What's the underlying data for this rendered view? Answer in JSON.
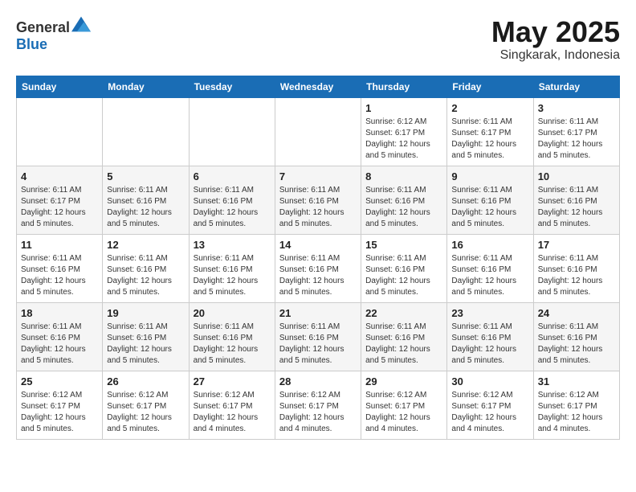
{
  "header": {
    "logo_general": "General",
    "logo_blue": "Blue",
    "title": "May 2025",
    "subtitle": "Singkarak, Indonesia"
  },
  "weekdays": [
    "Sunday",
    "Monday",
    "Tuesday",
    "Wednesday",
    "Thursday",
    "Friday",
    "Saturday"
  ],
  "weeks": [
    [
      {
        "day": "",
        "info": ""
      },
      {
        "day": "",
        "info": ""
      },
      {
        "day": "",
        "info": ""
      },
      {
        "day": "",
        "info": ""
      },
      {
        "day": "1",
        "info": "Sunrise: 6:12 AM\nSunset: 6:17 PM\nDaylight: 12 hours and 5 minutes."
      },
      {
        "day": "2",
        "info": "Sunrise: 6:11 AM\nSunset: 6:17 PM\nDaylight: 12 hours and 5 minutes."
      },
      {
        "day": "3",
        "info": "Sunrise: 6:11 AM\nSunset: 6:17 PM\nDaylight: 12 hours and 5 minutes."
      }
    ],
    [
      {
        "day": "4",
        "info": "Sunrise: 6:11 AM\nSunset: 6:17 PM\nDaylight: 12 hours and 5 minutes."
      },
      {
        "day": "5",
        "info": "Sunrise: 6:11 AM\nSunset: 6:16 PM\nDaylight: 12 hours and 5 minutes."
      },
      {
        "day": "6",
        "info": "Sunrise: 6:11 AM\nSunset: 6:16 PM\nDaylight: 12 hours and 5 minutes."
      },
      {
        "day": "7",
        "info": "Sunrise: 6:11 AM\nSunset: 6:16 PM\nDaylight: 12 hours and 5 minutes."
      },
      {
        "day": "8",
        "info": "Sunrise: 6:11 AM\nSunset: 6:16 PM\nDaylight: 12 hours and 5 minutes."
      },
      {
        "day": "9",
        "info": "Sunrise: 6:11 AM\nSunset: 6:16 PM\nDaylight: 12 hours and 5 minutes."
      },
      {
        "day": "10",
        "info": "Sunrise: 6:11 AM\nSunset: 6:16 PM\nDaylight: 12 hours and 5 minutes."
      }
    ],
    [
      {
        "day": "11",
        "info": "Sunrise: 6:11 AM\nSunset: 6:16 PM\nDaylight: 12 hours and 5 minutes."
      },
      {
        "day": "12",
        "info": "Sunrise: 6:11 AM\nSunset: 6:16 PM\nDaylight: 12 hours and 5 minutes."
      },
      {
        "day": "13",
        "info": "Sunrise: 6:11 AM\nSunset: 6:16 PM\nDaylight: 12 hours and 5 minutes."
      },
      {
        "day": "14",
        "info": "Sunrise: 6:11 AM\nSunset: 6:16 PM\nDaylight: 12 hours and 5 minutes."
      },
      {
        "day": "15",
        "info": "Sunrise: 6:11 AM\nSunset: 6:16 PM\nDaylight: 12 hours and 5 minutes."
      },
      {
        "day": "16",
        "info": "Sunrise: 6:11 AM\nSunset: 6:16 PM\nDaylight: 12 hours and 5 minutes."
      },
      {
        "day": "17",
        "info": "Sunrise: 6:11 AM\nSunset: 6:16 PM\nDaylight: 12 hours and 5 minutes."
      }
    ],
    [
      {
        "day": "18",
        "info": "Sunrise: 6:11 AM\nSunset: 6:16 PM\nDaylight: 12 hours and 5 minutes."
      },
      {
        "day": "19",
        "info": "Sunrise: 6:11 AM\nSunset: 6:16 PM\nDaylight: 12 hours and 5 minutes."
      },
      {
        "day": "20",
        "info": "Sunrise: 6:11 AM\nSunset: 6:16 PM\nDaylight: 12 hours and 5 minutes."
      },
      {
        "day": "21",
        "info": "Sunrise: 6:11 AM\nSunset: 6:16 PM\nDaylight: 12 hours and 5 minutes."
      },
      {
        "day": "22",
        "info": "Sunrise: 6:11 AM\nSunset: 6:16 PM\nDaylight: 12 hours and 5 minutes."
      },
      {
        "day": "23",
        "info": "Sunrise: 6:11 AM\nSunset: 6:16 PM\nDaylight: 12 hours and 5 minutes."
      },
      {
        "day": "24",
        "info": "Sunrise: 6:11 AM\nSunset: 6:16 PM\nDaylight: 12 hours and 5 minutes."
      }
    ],
    [
      {
        "day": "25",
        "info": "Sunrise: 6:12 AM\nSunset: 6:17 PM\nDaylight: 12 hours and 5 minutes."
      },
      {
        "day": "26",
        "info": "Sunrise: 6:12 AM\nSunset: 6:17 PM\nDaylight: 12 hours and 5 minutes."
      },
      {
        "day": "27",
        "info": "Sunrise: 6:12 AM\nSunset: 6:17 PM\nDaylight: 12 hours and 4 minutes."
      },
      {
        "day": "28",
        "info": "Sunrise: 6:12 AM\nSunset: 6:17 PM\nDaylight: 12 hours and 4 minutes."
      },
      {
        "day": "29",
        "info": "Sunrise: 6:12 AM\nSunset: 6:17 PM\nDaylight: 12 hours and 4 minutes."
      },
      {
        "day": "30",
        "info": "Sunrise: 6:12 AM\nSunset: 6:17 PM\nDaylight: 12 hours and 4 minutes."
      },
      {
        "day": "31",
        "info": "Sunrise: 6:12 AM\nSunset: 6:17 PM\nDaylight: 12 hours and 4 minutes."
      }
    ]
  ]
}
